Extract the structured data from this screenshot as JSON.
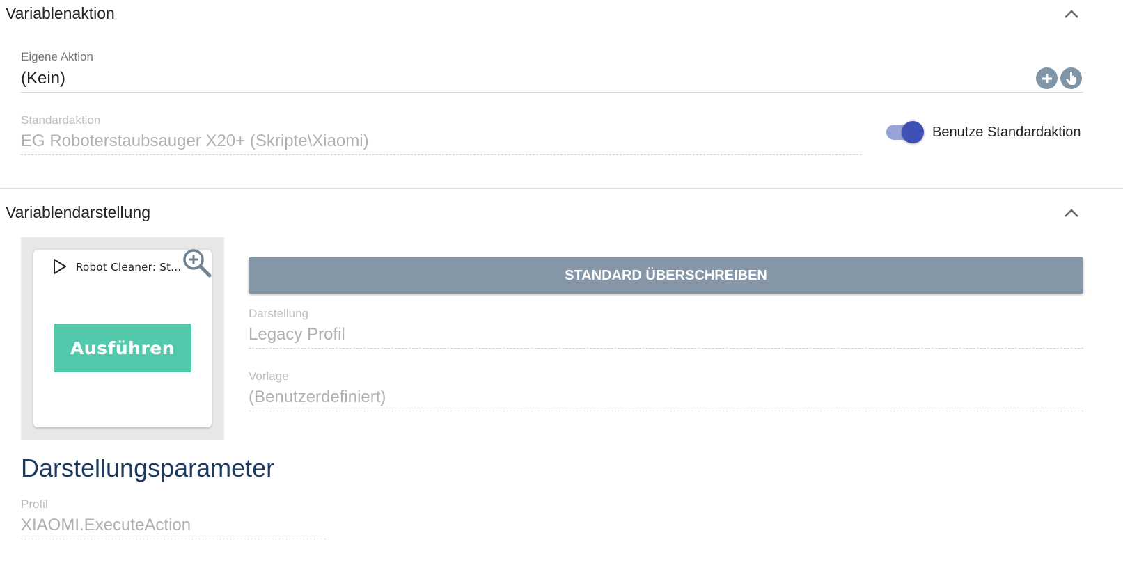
{
  "section_action": {
    "title": "Variablenaktion",
    "own_action_label": "Eigene Aktion",
    "own_action_value": "(Kein)",
    "default_action_label": "Standardaktion",
    "default_action_value": "EG Roboterstaubsauger X20+  (Skripte\\Xiaomi)",
    "use_default_label": "Benutze Standardaktion",
    "use_default_checked": true
  },
  "section_display": {
    "title": "Variablendarstellung",
    "preview": {
      "title": "Robot Cleaner: St...",
      "button_label": "Ausführen"
    },
    "override_button": "STANDARD ÜBERSCHREIBEN",
    "display_label": "Darstellung",
    "display_value": "Legacy Profil",
    "template_label": "Vorlage",
    "template_value": "(Benutzerdefiniert)",
    "params_heading": "Darstellungsparameter",
    "profile_label": "Profil",
    "profile_value": "XIAOMI.ExecuteAction"
  },
  "icons": [
    "chevron-up-icon",
    "plus-icon",
    "hand-pointer-icon",
    "play-icon",
    "zoom-in-icon"
  ],
  "colors": {
    "toggle_accent": "#3f51b5",
    "execute_button": "#52c9ac",
    "override_button": "#8597a7",
    "heading": "#1d3a5f"
  }
}
